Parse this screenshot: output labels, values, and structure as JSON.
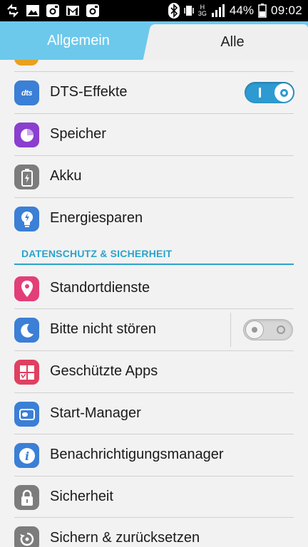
{
  "status_bar": {
    "battery_percent": "44%",
    "time": "09:02",
    "network_type": "3G",
    "hspa_label": "H",
    "left_icons": [
      "sync-icon",
      "image-icon",
      "instagram-icon",
      "gmail-icon",
      "instagram-icon"
    ],
    "right_icons": [
      "bluetooth-icon",
      "vibrate-icon",
      "signal-icon",
      "battery-icon"
    ]
  },
  "tabs": [
    {
      "label": "Allgemein",
      "selected": false
    },
    {
      "label": "Alle",
      "selected": true
    }
  ],
  "settings": {
    "items_top": [
      {
        "label": "DTS-Effekte",
        "icon": "dts-icon",
        "icon_color": "#3b7fd6",
        "toggle": true,
        "toggle_on": true
      },
      {
        "label": "Speicher",
        "icon": "storage-pie-icon",
        "icon_color": "#8a3fcf"
      },
      {
        "label": "Akku",
        "icon": "battery-icon",
        "icon_color": "#7c7c7c"
      },
      {
        "label": "Energiesparen",
        "icon": "power-saving-icon",
        "icon_color": "#3b7fd6"
      }
    ],
    "section_title": "DATENSCHUTZ & SICHERHEIT",
    "items_bottom": [
      {
        "label": "Standortdienste",
        "icon": "location-pin-icon",
        "icon_color": "#e23f78"
      },
      {
        "label": "Bitte nicht stören",
        "icon": "moon-icon",
        "icon_color": "#3b7fd6",
        "toggle": true,
        "toggle_on": false
      },
      {
        "label": "Geschützte Apps",
        "icon": "protected-apps-icon",
        "icon_color": "#e04060"
      },
      {
        "label": "Start-Manager",
        "icon": "startup-manager-icon",
        "icon_color": "#3b7fd6"
      },
      {
        "label": "Benachrichtigungsmanager",
        "icon": "info-icon",
        "icon_color": "#3b7fd6"
      },
      {
        "label": "Sicherheit",
        "icon": "lock-icon",
        "icon_color": "#7c7c7c"
      },
      {
        "label": "Sichern & zurücksetzen",
        "icon": "backup-restore-icon",
        "icon_color": "#7c7c7c"
      }
    ]
  },
  "colors": {
    "tab_bar": "#6cc9ec",
    "accent": "#2aa3cc",
    "toggle_on": "#2d9bd2"
  }
}
